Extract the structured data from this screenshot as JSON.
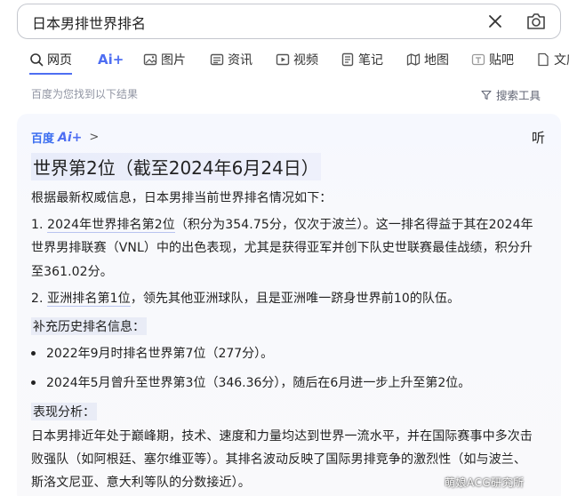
{
  "search": {
    "query": "日本男排世界排名"
  },
  "tabs": [
    {
      "label": "网页",
      "icon": "search-icon"
    },
    {
      "label": "Ai+",
      "icon": "ai-icon"
    },
    {
      "label": "图片",
      "icon": "image-icon"
    },
    {
      "label": "资讯",
      "icon": "news-icon"
    },
    {
      "label": "视频",
      "icon": "video-icon"
    },
    {
      "label": "笔记",
      "icon": "note-icon"
    },
    {
      "label": "地图",
      "icon": "map-icon"
    },
    {
      "label": "贴吧",
      "icon": "tieba-icon"
    },
    {
      "label": "文库",
      "icon": "doc-icon"
    }
  ],
  "results": {
    "count_text": "百度为您找到以下结果",
    "tools_label": "搜索工具"
  },
  "answer": {
    "brand_baidu": "百度",
    "brand_ai": "Ai+",
    "chevron": ">",
    "listen_label": "听",
    "title": "世界第2位（截至2024年6月24日）",
    "intro": "根据最新权威信息，日本男排当前世界排名情况如下：",
    "item1_prefix": "1. ",
    "item1_highlight": "2024年世界排名第2位",
    "item1_rest": "（积分为354.75分，仅次于波兰）。这一排名得益于其在2024年",
    "item1_line2": "世界男排联赛（VNL）中的出色表现，尤其是获得亚军并创下队史世联赛最佳战绩，积分升",
    "item1_line3": "至361.02分。",
    "item2_prefix": "2. ",
    "item2_highlight": "亚洲排名第1位",
    "item2_rest": "，领先其他亚洲球队，且是亚洲唯一跻身世界前10的队伍。",
    "history_heading": "补充历史排名信息：",
    "history": [
      "2022年9月时排名世界第7位（277分）。",
      "2024年5月曾升至世界第3位（346.36分），随后在6月进一步上升至第2位。"
    ],
    "analysis_heading": "表现分析：",
    "analysis_line1": "日本男排近年处于巅峰期，技术、速度和力量均达到世界一流水平，并在国际赛事中多次击",
    "analysis_line2": "败强队（如阿根廷、塞尔维亚等）。其排名波动反映了国际男排竞争的激烈性（如与波兰、",
    "analysis_line3": "斯洛文尼亚、意大利等队的分数接近）。"
  },
  "watermark": "萌娘ACG研究所"
}
